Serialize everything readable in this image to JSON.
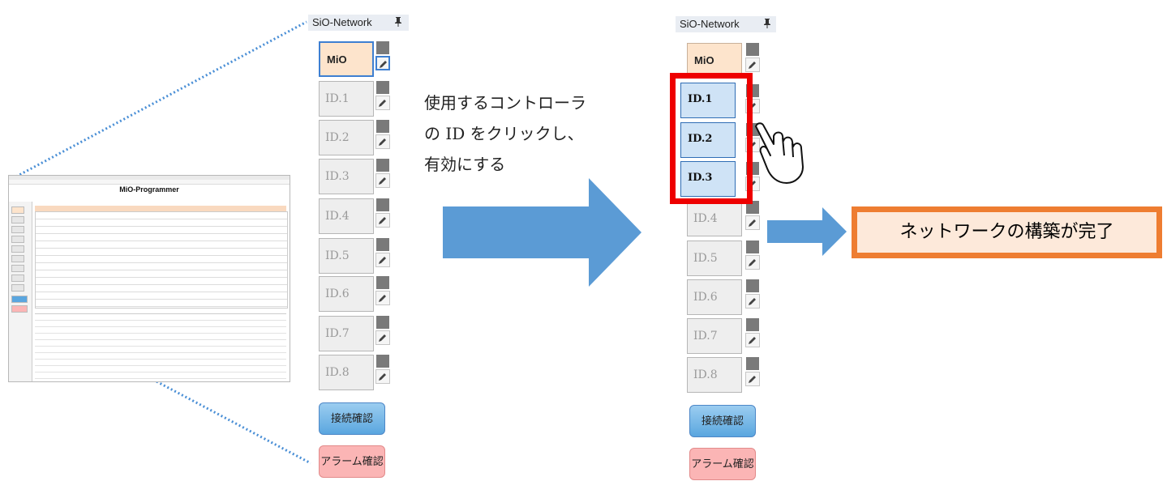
{
  "thumbnail": {
    "app_title": "MiO-Programmer"
  },
  "left_panel": {
    "title": "SiO-Network",
    "pin_icon": "\u0002",
    "mio_label": "MiO",
    "ids": [
      "ID.1",
      "ID.2",
      "ID.3",
      "ID.4",
      "ID.5",
      "ID.6",
      "ID.7",
      "ID.8"
    ],
    "connection_check": "接続確認",
    "alarm_check": "アラーム確認"
  },
  "instruction": {
    "line1": "使用するコントローラ",
    "line2": "の ID をクリックし、",
    "line3": "有効にする"
  },
  "right_panel": {
    "title": "SiO-Network",
    "mio_label": "MiO",
    "ids": [
      "ID.1",
      "ID.2",
      "ID.3",
      "ID.4",
      "ID.5",
      "ID.6",
      "ID.7",
      "ID.8"
    ],
    "active_ids": [
      "ID.1",
      "ID.2",
      "ID.3"
    ],
    "connection_check": "接続確認",
    "alarm_check": "アラーム確認"
  },
  "result_label": "ネットワークの構築が完了",
  "colors": {
    "arrow": "#5b9bd5",
    "highlight": "#ee0000",
    "result_border": "#ee7d31",
    "dotted_line": "#4a8fd6",
    "active_id": "#cfe3f6",
    "mio_bg": "#fde4cc"
  },
  "icons": {
    "pin": "pin-icon",
    "edit": "pencil-icon",
    "pointing_hand": "pointing-hand-icon"
  }
}
